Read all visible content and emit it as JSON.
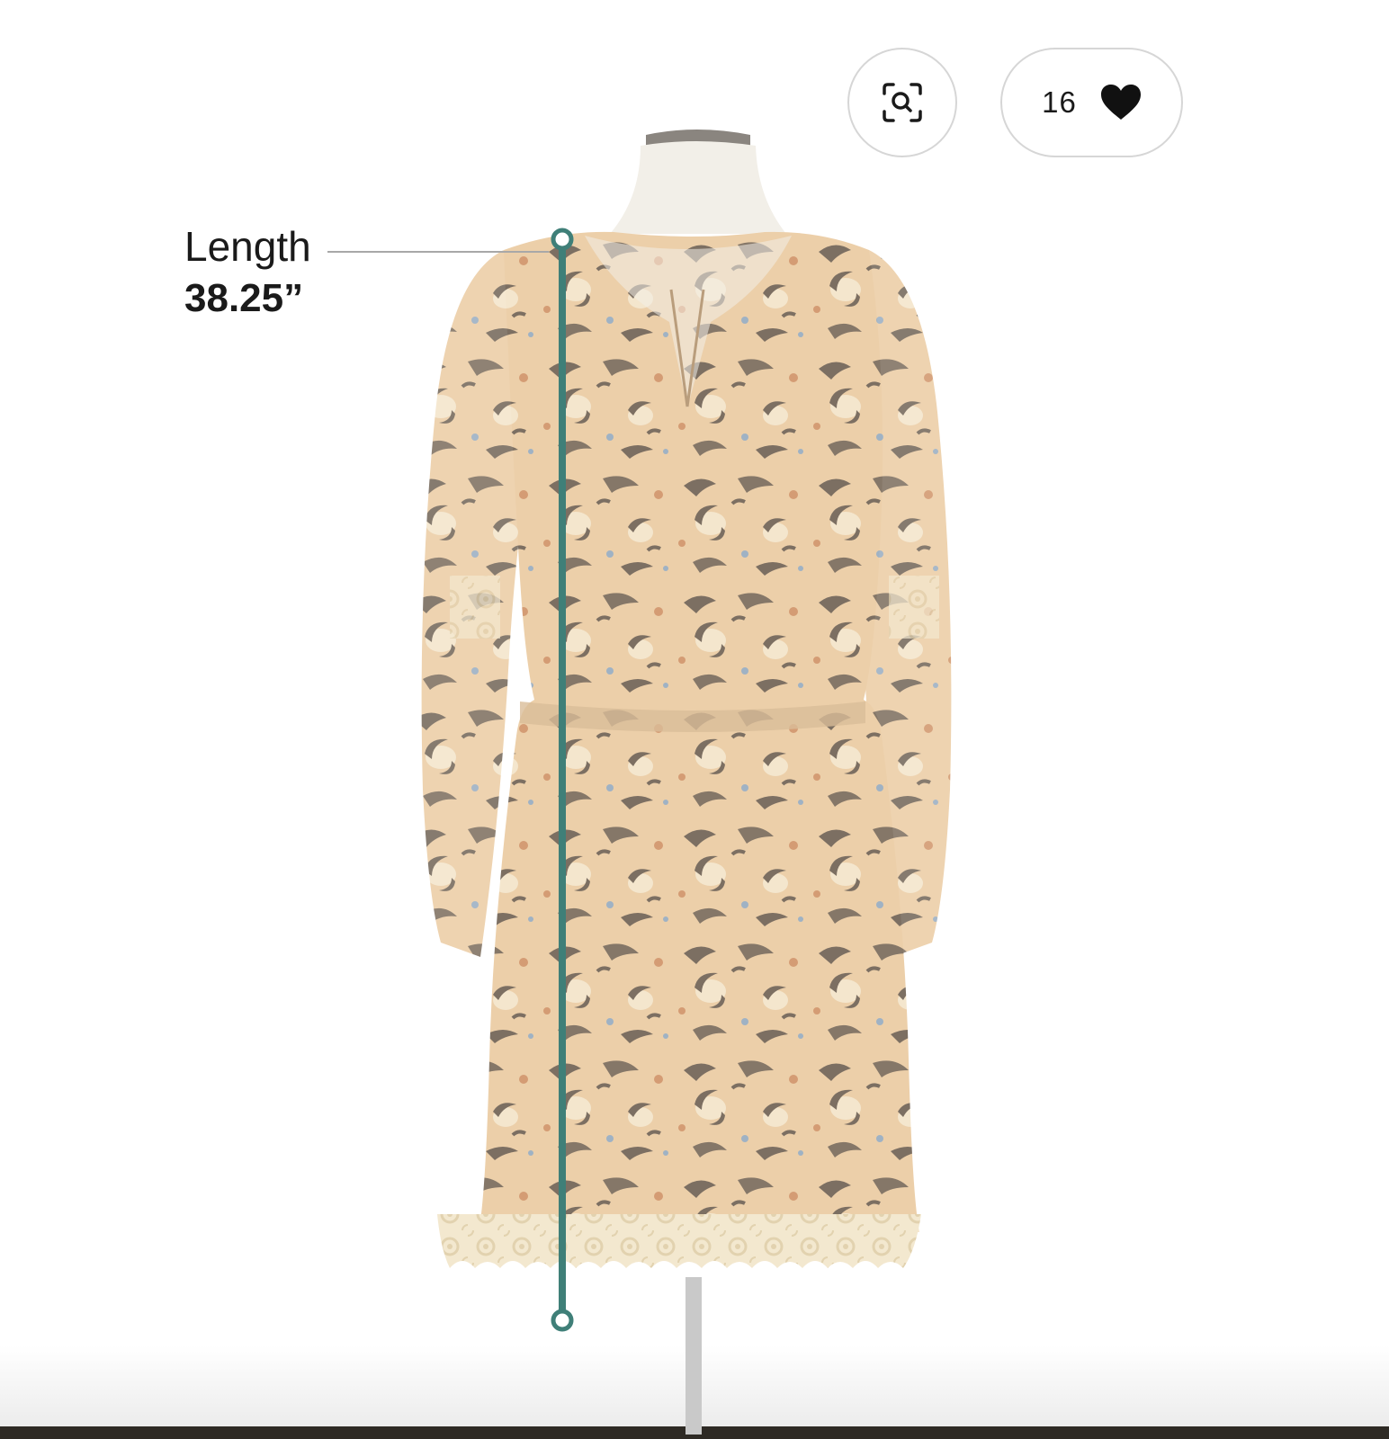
{
  "product_image": {
    "alt": "Dress on mannequin",
    "measurement": {
      "label": "Length",
      "value": "38.25”",
      "line_color": "#3f7f78"
    }
  },
  "actions": {
    "zoom": {
      "icon": "zoom-search-icon"
    },
    "favorite": {
      "count": "16",
      "icon": "heart-icon"
    }
  },
  "colors": {
    "fabric": "#eccfa9",
    "print_dark": "#7c6f62",
    "print_light": "#f4e6cd",
    "lace": "#f1e4c8",
    "mannequin": "#f2efe8"
  }
}
